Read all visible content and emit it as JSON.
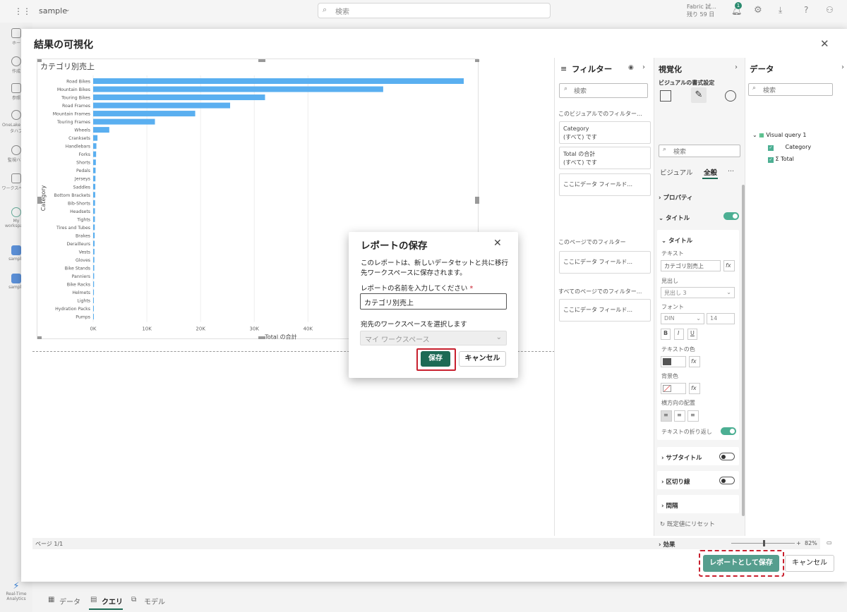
{
  "topbar": {
    "workspace": "sample",
    "search_placeholder": "検索",
    "trial_line1": "Fabric 試...",
    "trial_line2": "残り 59 日",
    "notif_count": "1"
  },
  "nav": {
    "items": [
      "ホー",
      "作成",
      "参照",
      "OneLake データハブ",
      "監視ハブ",
      "ワークスペース",
      "My workspace",
      "sample",
      "sample"
    ],
    "bottom": "Real-Time Analytics"
  },
  "modal": {
    "title": "結果の可視化",
    "page_label": "ページ 1/1",
    "zoom": "82%",
    "save_report": "レポートとして保存",
    "cancel": "キャンセル"
  },
  "bottom_tabs": {
    "data": "データ",
    "query": "クエリ",
    "model": "モデル"
  },
  "chart_data": {
    "type": "bar",
    "orientation": "horizontal",
    "title": "カテゴリ別売上",
    "xlabel": "Total の合計",
    "ylabel": "Category",
    "x_ticks": [
      "0K",
      "10K",
      "20K",
      "30K",
      "40K"
    ],
    "xlim": [
      0,
      69000
    ],
    "categories": [
      "Road Bikes",
      "Mountain Bikes",
      "Touring Bikes",
      "Road Frames",
      "Mountain Frames",
      "Touring Frames",
      "Wheels",
      "Cranksets",
      "Handlebars",
      "Forks",
      "Shorts",
      "Pedals",
      "Jerseys",
      "Saddles",
      "Bottom Brackets",
      "Bib-Shorts",
      "Headsets",
      "Tights",
      "Tires and Tubes",
      "Brakes",
      "Derailleurs",
      "Vests",
      "Gloves",
      "Bike Stands",
      "Panniers",
      "Bike Racks",
      "Helmets",
      "Lights",
      "Hydration Packs",
      "Pumps"
    ],
    "values": [
      69000,
      54000,
      32000,
      25500,
      19000,
      11500,
      3000,
      800,
      600,
      550,
      500,
      450,
      420,
      400,
      380,
      350,
      330,
      320,
      300,
      280,
      260,
      240,
      220,
      200,
      180,
      160,
      140,
      120,
      100,
      80
    ],
    "color": "#5aaff0"
  },
  "filters": {
    "title": "フィルター",
    "search": "検索",
    "visual_section": "このビジュアルでのフィルター...",
    "card1_title": "Category",
    "card1_sub": "(すべて) です",
    "card2_title": "Total の合計",
    "card2_sub": "(すべて) です",
    "drop_here": "ここにデータ フィールド...",
    "page_section": "このページでのフィルター",
    "all_section": "すべてのページでのフィルター..."
  },
  "viz": {
    "title": "視覚化",
    "format_label": "ビジュアルの書式設定",
    "search": "検索",
    "tab_visual": "ビジュアル",
    "tab_general": "全般",
    "more": "...",
    "properties": "プロパティ",
    "title_group": "タイトル",
    "title_sub": "タイトル",
    "text_label": "テキスト",
    "text_value": "カテゴリ別売上",
    "heading_label": "見出し",
    "heading_value": "見出し 3",
    "font_label": "フォント",
    "font_value": "DIN",
    "font_size": "14",
    "text_color_label": "テキストの色",
    "bg_label": "背景色",
    "align_label": "横方向の配置",
    "wrap_label": "テキストの折り返し",
    "subtitle": "サブタイトル",
    "divider": "区切り線",
    "spacing": "間隔",
    "reset": "既定値にリセット",
    "effects": "効果"
  },
  "datapane": {
    "title": "データ",
    "search": "検索",
    "query": "Visual query 1",
    "field1": "Category",
    "field2": "Total"
  },
  "dialog": {
    "title": "レポートの保存",
    "desc": "このレポートは、新しいデータセットと共に移行先ワークスペースに保存されます。",
    "name_label": "レポートの名前を入力してください",
    "name_value": "カテゴリ別売上",
    "ws_label": "宛先のワークスペースを選択します",
    "ws_value": "マイ ワークスペース",
    "save": "保存",
    "cancel": "キャンセル"
  }
}
